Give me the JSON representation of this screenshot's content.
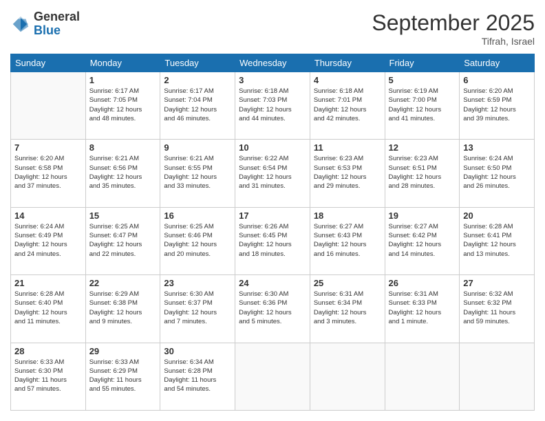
{
  "header": {
    "logo_general": "General",
    "logo_blue": "Blue",
    "month": "September 2025",
    "location": "Tifrah, Israel"
  },
  "weekdays": [
    "Sunday",
    "Monday",
    "Tuesday",
    "Wednesday",
    "Thursday",
    "Friday",
    "Saturday"
  ],
  "weeks": [
    [
      {
        "day": "",
        "info": ""
      },
      {
        "day": "1",
        "info": "Sunrise: 6:17 AM\nSunset: 7:05 PM\nDaylight: 12 hours\nand 48 minutes."
      },
      {
        "day": "2",
        "info": "Sunrise: 6:17 AM\nSunset: 7:04 PM\nDaylight: 12 hours\nand 46 minutes."
      },
      {
        "day": "3",
        "info": "Sunrise: 6:18 AM\nSunset: 7:03 PM\nDaylight: 12 hours\nand 44 minutes."
      },
      {
        "day": "4",
        "info": "Sunrise: 6:18 AM\nSunset: 7:01 PM\nDaylight: 12 hours\nand 42 minutes."
      },
      {
        "day": "5",
        "info": "Sunrise: 6:19 AM\nSunset: 7:00 PM\nDaylight: 12 hours\nand 41 minutes."
      },
      {
        "day": "6",
        "info": "Sunrise: 6:20 AM\nSunset: 6:59 PM\nDaylight: 12 hours\nand 39 minutes."
      }
    ],
    [
      {
        "day": "7",
        "info": "Sunrise: 6:20 AM\nSunset: 6:58 PM\nDaylight: 12 hours\nand 37 minutes."
      },
      {
        "day": "8",
        "info": "Sunrise: 6:21 AM\nSunset: 6:56 PM\nDaylight: 12 hours\nand 35 minutes."
      },
      {
        "day": "9",
        "info": "Sunrise: 6:21 AM\nSunset: 6:55 PM\nDaylight: 12 hours\nand 33 minutes."
      },
      {
        "day": "10",
        "info": "Sunrise: 6:22 AM\nSunset: 6:54 PM\nDaylight: 12 hours\nand 31 minutes."
      },
      {
        "day": "11",
        "info": "Sunrise: 6:23 AM\nSunset: 6:53 PM\nDaylight: 12 hours\nand 29 minutes."
      },
      {
        "day": "12",
        "info": "Sunrise: 6:23 AM\nSunset: 6:51 PM\nDaylight: 12 hours\nand 28 minutes."
      },
      {
        "day": "13",
        "info": "Sunrise: 6:24 AM\nSunset: 6:50 PM\nDaylight: 12 hours\nand 26 minutes."
      }
    ],
    [
      {
        "day": "14",
        "info": "Sunrise: 6:24 AM\nSunset: 6:49 PM\nDaylight: 12 hours\nand 24 minutes."
      },
      {
        "day": "15",
        "info": "Sunrise: 6:25 AM\nSunset: 6:47 PM\nDaylight: 12 hours\nand 22 minutes."
      },
      {
        "day": "16",
        "info": "Sunrise: 6:25 AM\nSunset: 6:46 PM\nDaylight: 12 hours\nand 20 minutes."
      },
      {
        "day": "17",
        "info": "Sunrise: 6:26 AM\nSunset: 6:45 PM\nDaylight: 12 hours\nand 18 minutes."
      },
      {
        "day": "18",
        "info": "Sunrise: 6:27 AM\nSunset: 6:43 PM\nDaylight: 12 hours\nand 16 minutes."
      },
      {
        "day": "19",
        "info": "Sunrise: 6:27 AM\nSunset: 6:42 PM\nDaylight: 12 hours\nand 14 minutes."
      },
      {
        "day": "20",
        "info": "Sunrise: 6:28 AM\nSunset: 6:41 PM\nDaylight: 12 hours\nand 13 minutes."
      }
    ],
    [
      {
        "day": "21",
        "info": "Sunrise: 6:28 AM\nSunset: 6:40 PM\nDaylight: 12 hours\nand 11 minutes."
      },
      {
        "day": "22",
        "info": "Sunrise: 6:29 AM\nSunset: 6:38 PM\nDaylight: 12 hours\nand 9 minutes."
      },
      {
        "day": "23",
        "info": "Sunrise: 6:30 AM\nSunset: 6:37 PM\nDaylight: 12 hours\nand 7 minutes."
      },
      {
        "day": "24",
        "info": "Sunrise: 6:30 AM\nSunset: 6:36 PM\nDaylight: 12 hours\nand 5 minutes."
      },
      {
        "day": "25",
        "info": "Sunrise: 6:31 AM\nSunset: 6:34 PM\nDaylight: 12 hours\nand 3 minutes."
      },
      {
        "day": "26",
        "info": "Sunrise: 6:31 AM\nSunset: 6:33 PM\nDaylight: 12 hours\nand 1 minute."
      },
      {
        "day": "27",
        "info": "Sunrise: 6:32 AM\nSunset: 6:32 PM\nDaylight: 11 hours\nand 59 minutes."
      }
    ],
    [
      {
        "day": "28",
        "info": "Sunrise: 6:33 AM\nSunset: 6:30 PM\nDaylight: 11 hours\nand 57 minutes."
      },
      {
        "day": "29",
        "info": "Sunrise: 6:33 AM\nSunset: 6:29 PM\nDaylight: 11 hours\nand 55 minutes."
      },
      {
        "day": "30",
        "info": "Sunrise: 6:34 AM\nSunset: 6:28 PM\nDaylight: 11 hours\nand 54 minutes."
      },
      {
        "day": "",
        "info": ""
      },
      {
        "day": "",
        "info": ""
      },
      {
        "day": "",
        "info": ""
      },
      {
        "day": "",
        "info": ""
      }
    ]
  ]
}
